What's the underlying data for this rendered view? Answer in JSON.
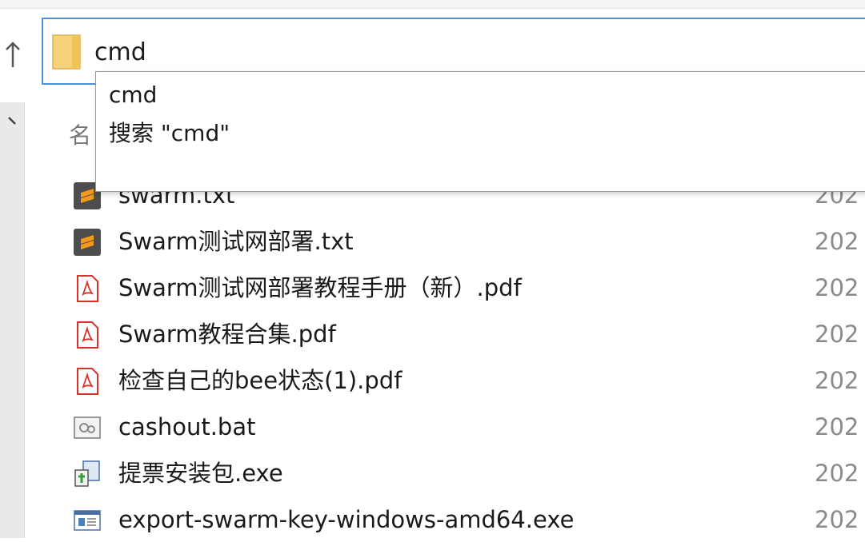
{
  "address_bar": {
    "value": "cmd"
  },
  "column_header_fragment": "名",
  "autocomplete": {
    "items": [
      {
        "label": "cmd"
      },
      {
        "label": "搜索 \"cmd\""
      }
    ]
  },
  "files": [
    {
      "name": "swarm.txt",
      "date": "202",
      "icon": "sublime-text-icon"
    },
    {
      "name": "Swarm测试网部署.txt",
      "date": "202",
      "icon": "sublime-text-icon"
    },
    {
      "name": "Swarm测试网部署教程手册（新）.pdf",
      "date": "202",
      "icon": "pdf-icon"
    },
    {
      "name": "Swarm教程合集.pdf",
      "date": "202",
      "icon": "pdf-icon"
    },
    {
      "name": "检查自己的bee状态(1).pdf",
      "date": "202",
      "icon": "pdf-icon"
    },
    {
      "name": "cashout.bat",
      "date": "202",
      "icon": "batch-file-icon"
    },
    {
      "name": "提票安装包.exe",
      "date": "202",
      "icon": "installer-icon"
    },
    {
      "name": "export-swarm-key-windows-amd64.exe",
      "date": "202",
      "icon": "exe-icon"
    }
  ],
  "colors": {
    "accent": "#4a93d8",
    "pdf_red": "#d9322a",
    "sublime_orange": "#f49a1a"
  }
}
